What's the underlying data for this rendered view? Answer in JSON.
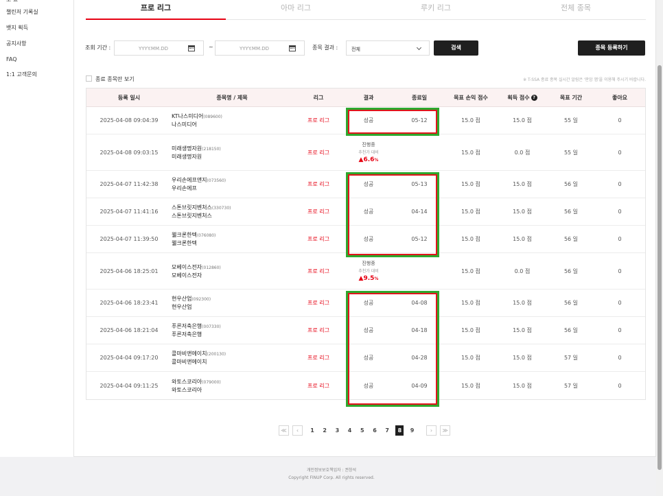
{
  "sidebar": {
    "partial_top": "보 뇨",
    "items": [
      "챌린저 기록실",
      "뱃지 획득",
      "공지사항",
      "FAQ",
      "1:1 고객문의"
    ]
  },
  "tabs": [
    "프로 리그",
    "아마 리그",
    "루키 리그",
    "전체 종목"
  ],
  "filter": {
    "period_label": "조회 기간 :",
    "start_placeholder": "YYYY.MM.DD",
    "end_placeholder": "YYYY.MM.DD",
    "tilde": "~",
    "result_label": "종목 결과 :",
    "result_value": "전체",
    "search_button": "검색",
    "register_button": "종목 등록하기"
  },
  "checkbox_label": "종료 종목만 보기",
  "notice": "※ T-SSA 종료 종목 실시간 알림은 '판암 앱'을 이용해 주시기 바랍니다.",
  "table": {
    "columns": [
      "등록 일시",
      "종목명 / 제목",
      "리그",
      "결과",
      "종료일",
      "목표 손익 점수",
      "획득 점수",
      "목표 기간",
      "좋아요"
    ],
    "help_icon": "?",
    "rows": [
      {
        "date": "2025-04-08 09:04:39",
        "name": "KT나스미디어",
        "code": "(089600)",
        "title": "나스미디어",
        "league": "프로 리그",
        "result": "성공",
        "end": "05-12",
        "target": "15.0 점",
        "earned": "15.0 점",
        "period": "55 일",
        "likes": "0"
      },
      {
        "date": "2025-04-08 09:03:15",
        "name": "미래생명자원",
        "code": "(218150)",
        "title": "미래생명자원",
        "league": "프로 리그",
        "result": "진행중",
        "result_sub": "추천가 대비",
        "result_pct": "▲6.6",
        "end": "",
        "target": "15.0 점",
        "earned": "0.0 점",
        "period": "55 일",
        "likes": "0"
      },
      {
        "date": "2025-04-07 11:42:38",
        "name": "우리손에프앤지",
        "code": "(073560)",
        "title": "우리손에프",
        "league": "프로 리그",
        "result": "성공",
        "end": "05-13",
        "target": "15.0 점",
        "earned": "15.0 점",
        "period": "56 일",
        "likes": "0"
      },
      {
        "date": "2025-04-07 11:41:16",
        "name": "스톤브릿지벤처스",
        "code": "(330730)",
        "title": "스톤브릿지벤처스",
        "league": "프로 리그",
        "result": "성공",
        "end": "04-14",
        "target": "15.0 점",
        "earned": "15.0 점",
        "period": "56 일",
        "likes": "0"
      },
      {
        "date": "2025-04-07 11:39:50",
        "name": "웰크론한텍",
        "code": "(076080)",
        "title": "웰크론한텍",
        "league": "프로 리그",
        "result": "성공",
        "end": "05-12",
        "target": "15.0 점",
        "earned": "15.0 점",
        "period": "56 일",
        "likes": "0"
      },
      {
        "date": "2025-04-06 18:25:01",
        "name": "모베이스전자",
        "code": "(012860)",
        "title": "모베이스전자",
        "league": "프로 리그",
        "result": "진행중",
        "result_sub": "추천가 대비",
        "result_pct": "▲9.5",
        "end": "",
        "target": "15.0 점",
        "earned": "0.0 점",
        "period": "56 일",
        "likes": "0"
      },
      {
        "date": "2025-04-06 18:23:41",
        "name": "현우산업",
        "code": "(092300)",
        "title": "현우산업",
        "league": "프로 리그",
        "result": "성공",
        "end": "04-08",
        "target": "15.0 점",
        "earned": "15.0 점",
        "period": "56 일",
        "likes": "0"
      },
      {
        "date": "2025-04-06 18:21:04",
        "name": "푸른저축은행",
        "code": "(007330)",
        "title": "푸른저축은행",
        "league": "프로 리그",
        "result": "성공",
        "end": "04-18",
        "target": "15.0 점",
        "earned": "15.0 점",
        "period": "56 일",
        "likes": "0"
      },
      {
        "date": "2025-04-04 09:17:20",
        "name": "콜마비앤에이치",
        "code": "(200130)",
        "title": "콜마비앤에이치",
        "league": "프로 리그",
        "result": "성공",
        "end": "04-28",
        "target": "15.0 점",
        "earned": "15.0 점",
        "period": "57 일",
        "likes": "0"
      },
      {
        "date": "2025-04-04 09:11:25",
        "name": "와토스코리아",
        "code": "(079000)",
        "title": "와토스코리아",
        "league": "프로 리그",
        "result": "성공",
        "end": "04-09",
        "target": "15.0 점",
        "earned": "15.0 점",
        "period": "57 일",
        "likes": "0"
      }
    ]
  },
  "pagination": {
    "first": "≪",
    "prev": "‹",
    "pages": [
      "1",
      "2",
      "3",
      "4",
      "5",
      "6",
      "7",
      "8",
      "9"
    ],
    "current": "8",
    "next": "›",
    "last": "≫"
  },
  "footer": {
    "line1": "개인정보보호책임자 : 권창석",
    "line2": "Copyright FINUP Corp. All rights reserved."
  },
  "colors": {
    "accent": "#e60012",
    "highlight_green": "#2ea82e",
    "highlight_red": "#e0141c",
    "dark_button": "#1f1f1f"
  }
}
